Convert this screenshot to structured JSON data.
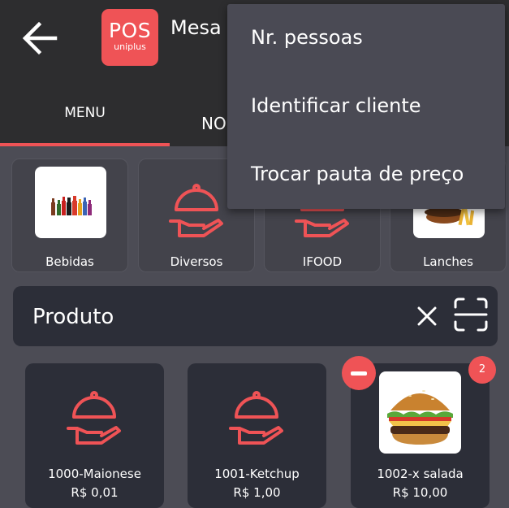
{
  "app": {
    "logo_main": "POS",
    "logo_sub": "uniplus",
    "title": "Mesa"
  },
  "colors": {
    "accent": "#ef5356",
    "bar": "#2d2d2f",
    "background": "#4c4c55",
    "card": "#2c2e38"
  },
  "tabs": [
    {
      "label": "MENU",
      "active": true
    },
    {
      "label": "NO",
      "active": false
    }
  ],
  "categories": [
    {
      "label": "Bebidas",
      "icon": "bottles-image"
    },
    {
      "label": "Diversos",
      "icon": "cloche-icon"
    },
    {
      "label": "IFOOD",
      "icon": "cloche-icon"
    },
    {
      "label": "Lanches",
      "icon": "burger-fries-image"
    }
  ],
  "search": {
    "placeholder": "Produto"
  },
  "products": [
    {
      "name": "1000-Maionese",
      "price": "R$ 0,01",
      "icon": "cloche-icon"
    },
    {
      "name": "1001-Ketchup",
      "price": "R$ 1,00",
      "icon": "cloche-icon"
    },
    {
      "name": "1002-x salada",
      "price": "R$ 10,00",
      "icon": "burger-image",
      "quantity": "2"
    }
  ],
  "menu": {
    "items": [
      "Nr. pessoas",
      "Identificar cliente",
      "Trocar pauta de preço"
    ]
  }
}
